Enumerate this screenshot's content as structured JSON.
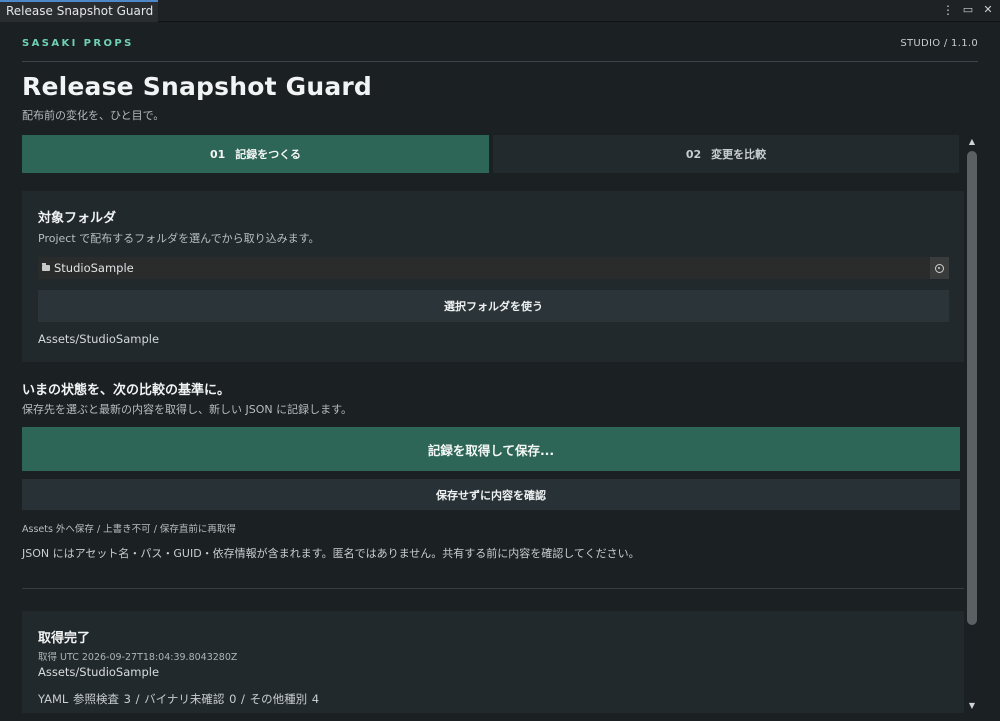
{
  "window": {
    "tab_title": "Release Snapshot Guard",
    "menu_icon": "more-vert-icon",
    "maximize_icon": "maximize-icon",
    "close_icon": "close-icon"
  },
  "header": {
    "brand": "SASAKI PROPS",
    "version": "STUDIO  /  1.1.0",
    "title": "Release Snapshot Guard",
    "subtitle": "配布前の変化を、ひと目で。"
  },
  "tabs": [
    {
      "number": "01",
      "label": "記録をつくる",
      "active": true
    },
    {
      "number": "02",
      "label": "変更を比較",
      "active": false
    }
  ],
  "target_folder": {
    "title": "対象フォルダ",
    "description": "Project で配布するフォルダを選んでから取り込みます。",
    "field_value": "StudioSample",
    "use_selected_button": "選択フォルダを使う",
    "path": "Assets/StudioSample"
  },
  "snapshot": {
    "title": "いまの状態を、次の比較の基準に。",
    "description": "保存先を選ぶと最新の内容を取得し、新しい JSON に記録します。",
    "capture_button": "記録を取得して保存...",
    "preview_button": "保存せずに内容を確認",
    "flags": "Assets 外へ保存  /  上書き不可  /  保存直前に再取得",
    "notice": "JSON にはアセット名・パス・GUID・依存情報が含まれます。匿名ではありません。共有する前に内容を確認してください。"
  },
  "result": {
    "title": "取得完了",
    "meta": "取得 UTC  2026-09-27T18:04:39.8043280Z",
    "path": "Assets/StudioSample",
    "stats": "YAML 参照検査 3   /   バイナリ未確認 0   /   その他種別 4"
  },
  "colors": {
    "accent": "#2d6656",
    "brand": "#6fd1b2",
    "background": "#1b2023",
    "card": "#22292c"
  }
}
